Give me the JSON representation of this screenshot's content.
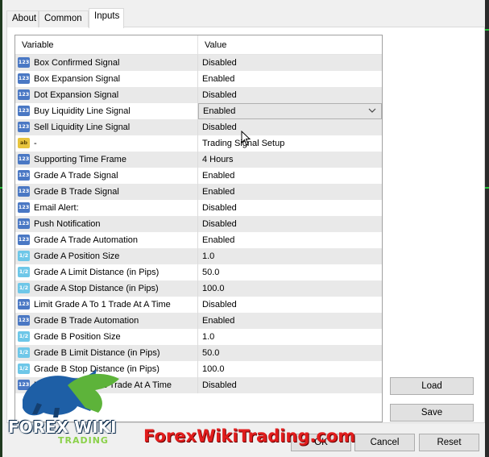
{
  "tabs": [
    {
      "label": "About"
    },
    {
      "label": "Common"
    },
    {
      "label": "Inputs"
    }
  ],
  "grid": {
    "header": {
      "variable": "Variable",
      "value": "Value"
    },
    "rows": [
      {
        "type": "bool",
        "icon": "bool-type-icon",
        "variable": "Box Confirmed Signal",
        "value": "Disabled"
      },
      {
        "type": "bool",
        "icon": "bool-type-icon",
        "variable": "Box Expansion Signal",
        "value": "Enabled"
      },
      {
        "type": "bool",
        "icon": "bool-type-icon",
        "variable": "Dot Expansion Signal",
        "value": "Disabled"
      },
      {
        "type": "bool",
        "icon": "bool-type-icon",
        "variable": "Buy Liquidity Line Signal",
        "value": "Enabled"
      },
      {
        "type": "bool",
        "icon": "bool-type-icon",
        "variable": "Sell Liquidity Line Signal",
        "value": "Disabled"
      },
      {
        "type": "str",
        "icon": "string-type-icon",
        "variable": "-",
        "value": "Trading Signal Setup"
      },
      {
        "type": "bool",
        "icon": "enum-type-icon",
        "variable": "Supporting Time Frame",
        "value": "4 Hours"
      },
      {
        "type": "bool",
        "icon": "bool-type-icon",
        "variable": "Grade A Trade Signal",
        "value": "Enabled"
      },
      {
        "type": "bool",
        "icon": "bool-type-icon",
        "variable": "Grade B Trade Signal",
        "value": "Enabled"
      },
      {
        "type": "bool",
        "icon": "bool-type-icon",
        "variable": "Email Alert:",
        "value": "Disabled"
      },
      {
        "type": "bool",
        "icon": "bool-type-icon",
        "variable": "Push Notification",
        "value": "Disabled"
      },
      {
        "type": "bool",
        "icon": "bool-type-icon",
        "variable": "Grade A Trade Automation",
        "value": "Enabled"
      },
      {
        "type": "num",
        "icon": "double-type-icon",
        "variable": "Grade A Position Size",
        "value": "1.0"
      },
      {
        "type": "num",
        "icon": "double-type-icon",
        "variable": "Grade A Limit Distance (in Pips)",
        "value": "50.0"
      },
      {
        "type": "num",
        "icon": "double-type-icon",
        "variable": "Grade A Stop Distance (in Pips)",
        "value": "100.0"
      },
      {
        "type": "bool",
        "icon": "bool-type-icon",
        "variable": "Limit Grade A To 1 Trade At A Time",
        "value": "Disabled"
      },
      {
        "type": "bool",
        "icon": "bool-type-icon",
        "variable": "Grade B Trade Automation",
        "value": "Enabled"
      },
      {
        "type": "num",
        "icon": "double-type-icon",
        "variable": "Grade B Position Size",
        "value": "1.0"
      },
      {
        "type": "num",
        "icon": "double-type-icon",
        "variable": "Grade B Limit Distance (in Pips)",
        "value": "50.0"
      },
      {
        "type": "num",
        "icon": "double-type-icon",
        "variable": "Grade B Stop Distance (in Pips)",
        "value": "100.0"
      },
      {
        "type": "bool",
        "icon": "bool-type-icon",
        "variable": "Limit Grade B To 1 Trade At A Time",
        "value": "Disabled"
      }
    ],
    "selected_row": 3
  },
  "buttons": {
    "load": "Load",
    "save": "Save",
    "ok": "OK",
    "cancel": "Cancel",
    "reset": "Reset"
  },
  "overlay": {
    "logo_text": "FOREX WIKI",
    "logo_subtext": "TRADING",
    "watermark": "ForexWikiTrading.com"
  },
  "colors": {
    "bool_icon": "#4a78c4",
    "double_icon": "#6ec7e8",
    "string_icon": "#e8c43c",
    "watermark": "#e11d1d"
  }
}
